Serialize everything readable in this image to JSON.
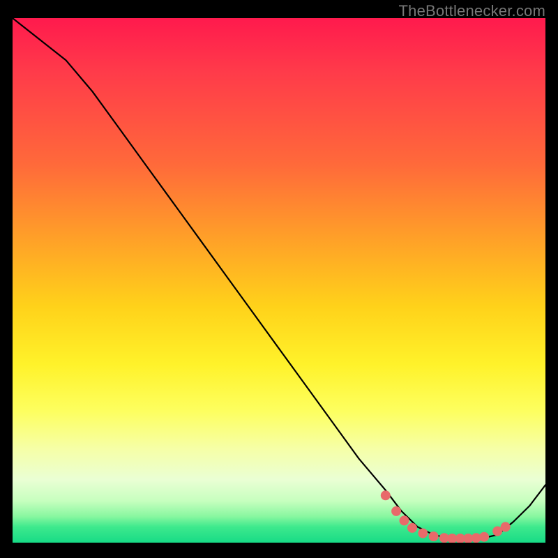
{
  "attribution": "TheBottlenecker.com",
  "chart_data": {
    "type": "line",
    "title": "",
    "xlabel": "",
    "ylabel": "",
    "xlim": [
      0,
      100
    ],
    "ylim": [
      0,
      100
    ],
    "series": [
      {
        "name": "bottleneck-curve",
        "x": [
          0,
          5,
          10,
          15,
          20,
          25,
          30,
          35,
          40,
          45,
          50,
          55,
          60,
          65,
          70,
          73,
          76,
          79,
          82,
          85,
          88,
          91,
          94,
          97,
          100
        ],
        "y": [
          100,
          96,
          92,
          86,
          79,
          72,
          65,
          58,
          51,
          44,
          37,
          30,
          23,
          16,
          10,
          6,
          3,
          1.5,
          0.8,
          0.5,
          0.8,
          1.5,
          4,
          7,
          11
        ]
      }
    ],
    "markers": {
      "name": "highlight-dots",
      "x": [
        70,
        72,
        73.5,
        75,
        77,
        79,
        81,
        82.5,
        84,
        85.5,
        87,
        88.5,
        91,
        92.5
      ],
      "y": [
        9,
        6,
        4.2,
        2.8,
        1.8,
        1.2,
        0.9,
        0.8,
        0.8,
        0.8,
        0.9,
        1.1,
        2.2,
        3.0
      ]
    },
    "colors": {
      "curve": "#000000",
      "marker": "#e86a6a",
      "gradient_top": "#ff1a4d",
      "gradient_bottom": "#17db86"
    }
  }
}
